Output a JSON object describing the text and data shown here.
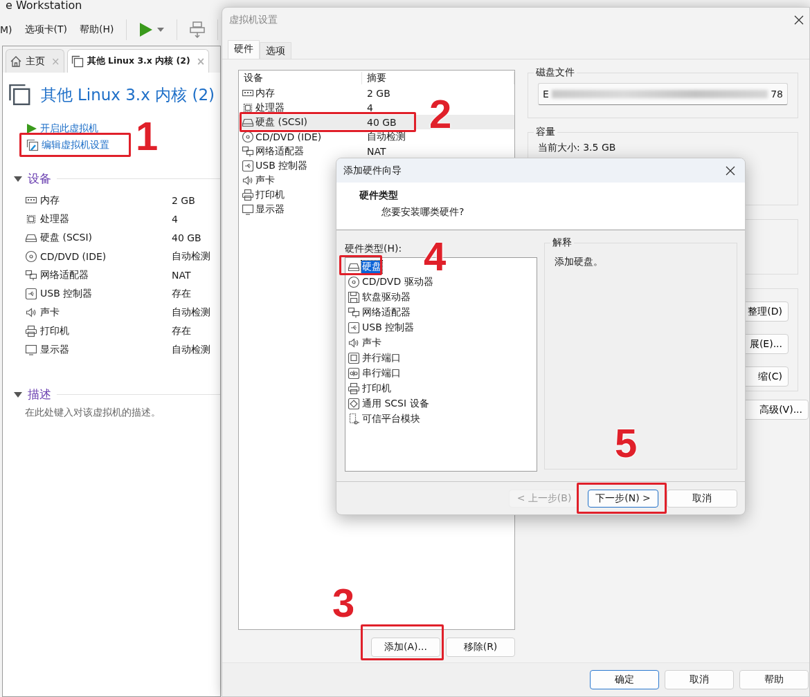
{
  "app_window": {
    "title": "e Workstation",
    "menu": [
      {
        "label": "M)"
      },
      {
        "label": "选项卡(T)"
      },
      {
        "label": "帮助(H)"
      }
    ],
    "tabs": [
      {
        "kind": "home",
        "label": "主页",
        "close": "×",
        "selected": false
      },
      {
        "kind": "vm",
        "label": "其他 Linux 3.x 内核 (2)",
        "close": "×",
        "selected": true
      }
    ],
    "vm_title": "其他 Linux 3.x 内核 (2)",
    "actions": [
      {
        "kind": "power",
        "label": "开启此虚拟机"
      },
      {
        "kind": "edit",
        "label": "编辑虚拟机设置"
      }
    ],
    "devices_heading": "设备",
    "devices": [
      {
        "kind": "memory",
        "name": "内存",
        "value": "2 GB"
      },
      {
        "kind": "cpu",
        "name": "处理器",
        "value": "4"
      },
      {
        "kind": "disk",
        "name": "硬盘 (SCSI)",
        "value": "40 GB"
      },
      {
        "kind": "cdrom",
        "name": "CD/DVD (IDE)",
        "value": "自动检测"
      },
      {
        "kind": "network",
        "name": "网络适配器",
        "value": "NAT"
      },
      {
        "kind": "usb",
        "name": "USB 控制器",
        "value": "存在"
      },
      {
        "kind": "sound",
        "name": "声卡",
        "value": "自动检测"
      },
      {
        "kind": "printer",
        "name": "打印机",
        "value": "存在"
      },
      {
        "kind": "display",
        "name": "显示器",
        "value": "自动检测"
      }
    ],
    "description_heading": "描述",
    "description_placeholder": "在此处键入对该虚拟机的描述。"
  },
  "settings_dialog": {
    "title": "虚拟机设置",
    "tabs": [
      {
        "label": "硬件",
        "selected": true
      },
      {
        "label": "选项",
        "selected": false
      }
    ],
    "columns": [
      "设备",
      "摘要"
    ],
    "devices": [
      {
        "kind": "memory",
        "name": "内存",
        "summary": "2 GB",
        "selected": false
      },
      {
        "kind": "cpu",
        "name": "处理器",
        "summary": "4",
        "selected": false
      },
      {
        "kind": "disk",
        "name": "硬盘 (SCSI)",
        "summary": "40 GB",
        "selected": true
      },
      {
        "kind": "cdrom",
        "name": "CD/DVD (IDE)",
        "summary": "自动检测",
        "selected": false
      },
      {
        "kind": "network",
        "name": "网络适配器",
        "summary": "NAT",
        "selected": false
      },
      {
        "kind": "usb",
        "name": "USB 控制器",
        "selected": false
      },
      {
        "kind": "sound",
        "name": "声卡",
        "selected": false
      },
      {
        "kind": "printer",
        "name": "打印机",
        "selected": false
      },
      {
        "kind": "display",
        "name": "显示器",
        "selected": false
      }
    ],
    "disk_file": {
      "label": "磁盘文件",
      "value_start": "E",
      "value_end": "78"
    },
    "capacity": {
      "label": "容量",
      "current_size": "当前大小: 3.5 GB"
    },
    "disk_buttons": [
      "整理(D)",
      "展(E)...",
      "缩(C)"
    ],
    "advanced_button": "高级(V)...",
    "list_buttons": [
      "添加(A)...",
      "移除(R)"
    ],
    "footer_buttons": [
      {
        "label": "确定",
        "default": true
      },
      {
        "label": "取消",
        "default": false
      },
      {
        "label": "帮助",
        "default": false
      }
    ]
  },
  "wizard": {
    "title": "添加硬件向导",
    "heading": "硬件类型",
    "subheading": "您要安装哪类硬件?",
    "list_label": "硬件类型(H):",
    "hardware_types": [
      {
        "kind": "disk",
        "label": "硬盘",
        "selected": true
      },
      {
        "kind": "cdrom",
        "label": "CD/DVD 驱动器",
        "selected": false
      },
      {
        "kind": "floppy",
        "label": "软盘驱动器",
        "selected": false
      },
      {
        "kind": "network",
        "label": "网络适配器",
        "selected": false
      },
      {
        "kind": "usb",
        "label": "USB 控制器",
        "selected": false
      },
      {
        "kind": "sound",
        "label": "声卡",
        "selected": false
      },
      {
        "kind": "parallel",
        "label": "并行端口",
        "selected": false
      },
      {
        "kind": "serial",
        "label": "串行端口",
        "selected": false
      },
      {
        "kind": "printer",
        "label": "打印机",
        "selected": false
      },
      {
        "kind": "scsi",
        "label": "通用 SCSI 设备",
        "selected": false
      },
      {
        "kind": "tpm",
        "label": "可信平台模块",
        "selected": false
      }
    ],
    "explanation_label": "解释",
    "explanation": "添加硬盘。",
    "buttons": [
      {
        "label": "< 上一步(B)",
        "disabled": true,
        "default": false
      },
      {
        "label": "下一步(N) >",
        "disabled": false,
        "default": true
      },
      {
        "label": "取消",
        "disabled": false,
        "default": false
      }
    ]
  },
  "annotations": [
    {
      "label": "1"
    },
    {
      "label": "2"
    },
    {
      "label": "3"
    },
    {
      "label": "4"
    },
    {
      "label": "5"
    }
  ]
}
